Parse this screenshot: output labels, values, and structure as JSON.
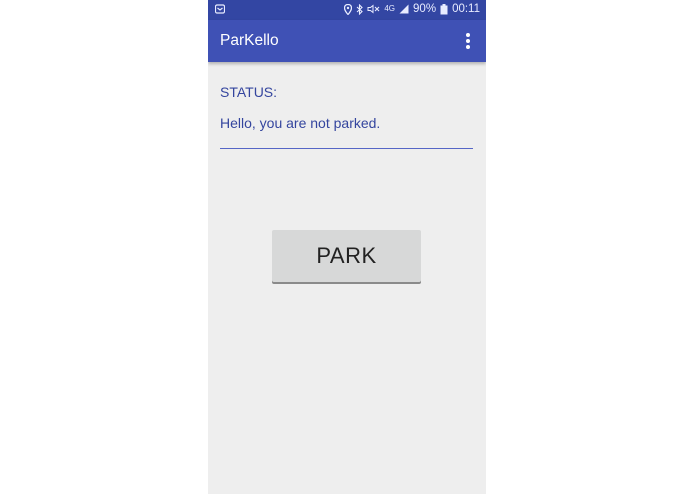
{
  "status_bar": {
    "battery_percent": "90%",
    "time": "00:11",
    "network": "4G",
    "icons": [
      "notification-icon",
      "location-icon",
      "bluetooth-icon",
      "mute-icon",
      "signal-icon",
      "battery-icon"
    ]
  },
  "app_bar": {
    "title": "ParKello",
    "menu_icon": "overflow-menu-icon"
  },
  "main": {
    "status_label": "STATUS:",
    "status_text": "Hello, you are not parked.",
    "park_button_label": "PARK"
  },
  "colors": {
    "primary": "#3f51b5",
    "primary_dark": "#3346a3",
    "accent_text": "#34459e",
    "background": "#eeeeee",
    "button": "#d7d8d8"
  }
}
